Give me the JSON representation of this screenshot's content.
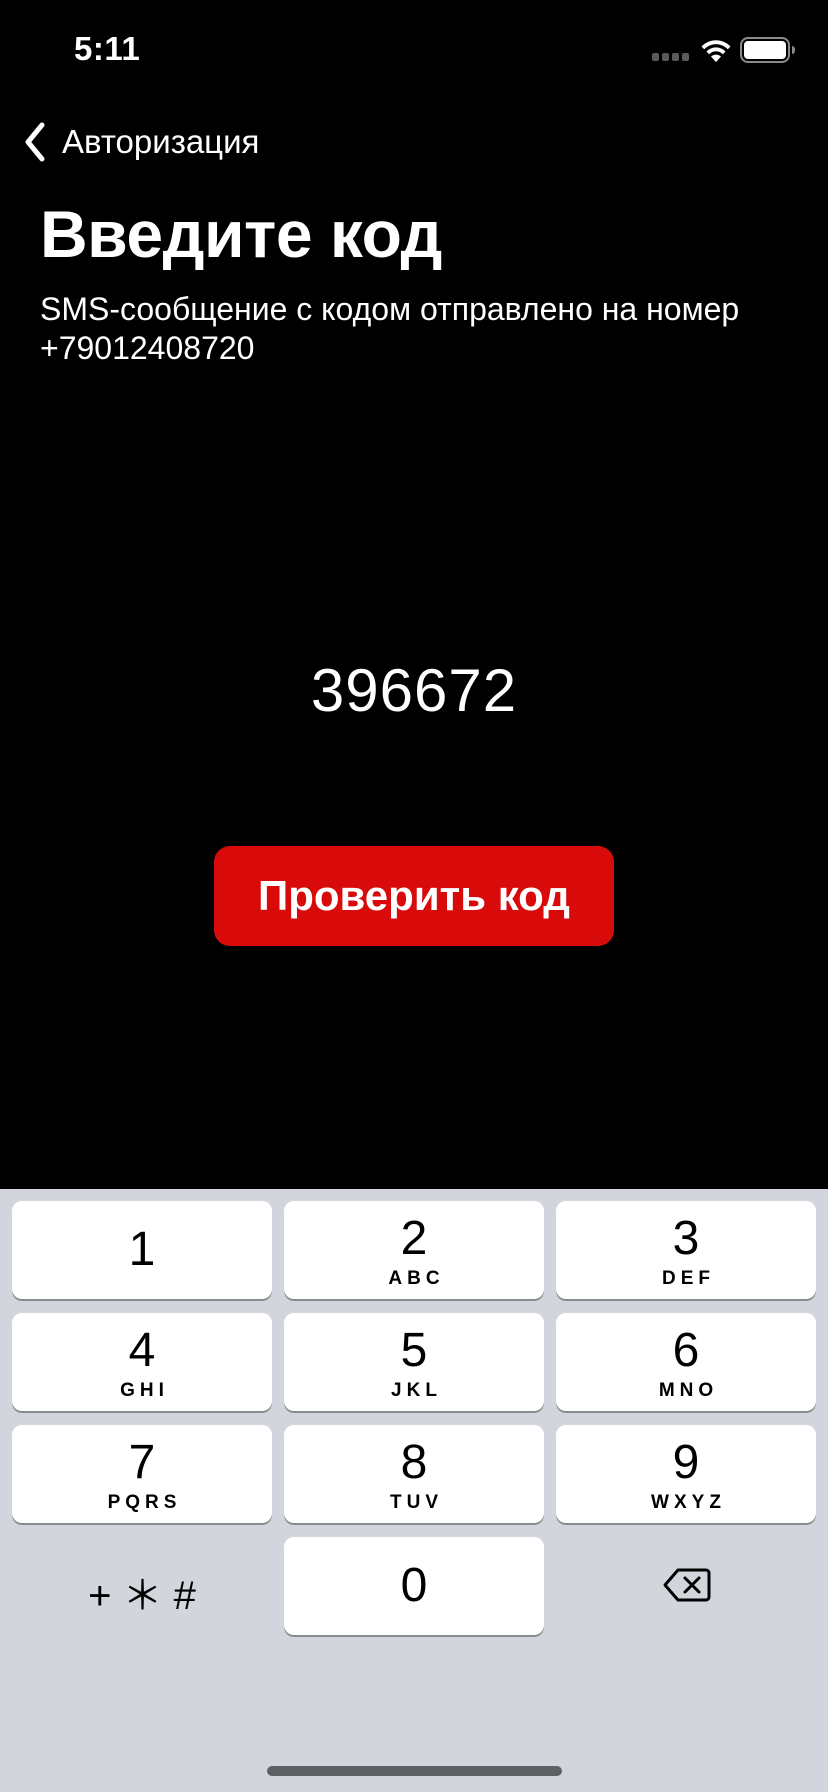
{
  "status_bar": {
    "time": "5:11",
    "icons": [
      "signal-icon",
      "wifi-icon",
      "battery-icon"
    ]
  },
  "nav": {
    "back_label": "Авторизация",
    "back_icon": "chevron-left-icon"
  },
  "header": {
    "title": "Введите код",
    "subtitle": "SMS-сообщение с кодом отправлено на номер +79012408720"
  },
  "code": {
    "value": "396672"
  },
  "verify_button": {
    "label": "Проверить код",
    "color": "#d80a0a"
  },
  "keypad": {
    "background": "#d2d5db",
    "keys": [
      {
        "digit": "1",
        "letters": ""
      },
      {
        "digit": "2",
        "letters": "ABC"
      },
      {
        "digit": "3",
        "letters": "DEF"
      },
      {
        "digit": "4",
        "letters": "GHI"
      },
      {
        "digit": "5",
        "letters": "JKL"
      },
      {
        "digit": "6",
        "letters": "MNO"
      },
      {
        "digit": "7",
        "letters": "PQRS"
      },
      {
        "digit": "8",
        "letters": "TUV"
      },
      {
        "digit": "9",
        "letters": "WXYZ"
      },
      {
        "digit": "0",
        "letters": ""
      }
    ],
    "symbols_label": "+ ＊ #",
    "delete_icon": "delete-backspace-icon"
  }
}
